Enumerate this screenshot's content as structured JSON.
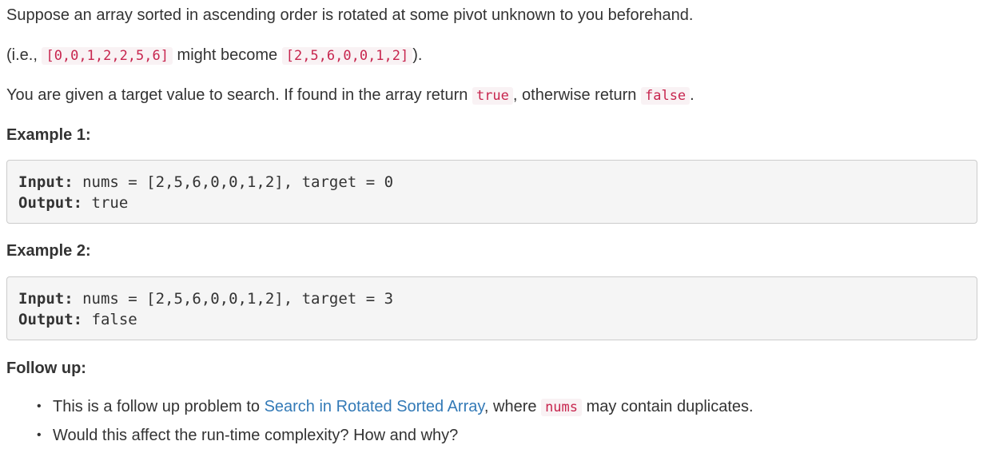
{
  "intro": {
    "line1": "Suppose an array sorted in ascending order is rotated at some pivot unknown to you beforehand.",
    "ie_prefix": "(i.e., ",
    "ie_code1": "[0,0,1,2,2,5,6]",
    "ie_middle": " might become ",
    "ie_code2": "[2,5,6,0,0,1,2]",
    "ie_suffix": ").",
    "target_prefix": "You are given a target value to search. If found in the array return ",
    "target_code_true": "true",
    "target_middle": ", otherwise return ",
    "target_code_false": "false",
    "target_suffix": "."
  },
  "examples": [
    {
      "heading": "Example 1:",
      "input_label": "Input:",
      "input_value": " nums = [2,5,6,0,0,1,2], target = 0",
      "output_label": "Output:",
      "output_value": " true"
    },
    {
      "heading": "Example 2:",
      "input_label": "Input:",
      "input_value": " nums = [2,5,6,0,0,1,2], target = 3",
      "output_label": "Output:",
      "output_value": " false"
    }
  ],
  "followup": {
    "heading": "Follow up:",
    "bullet": "•",
    "item1_prefix": "This is a follow up problem to ",
    "item1_link": "Search in Rotated Sorted Array",
    "item1_middle": ", where ",
    "item1_code": "nums",
    "item1_suffix": " may contain duplicates.",
    "item2": "Would this affect the run-time complexity? How and why?"
  }
}
